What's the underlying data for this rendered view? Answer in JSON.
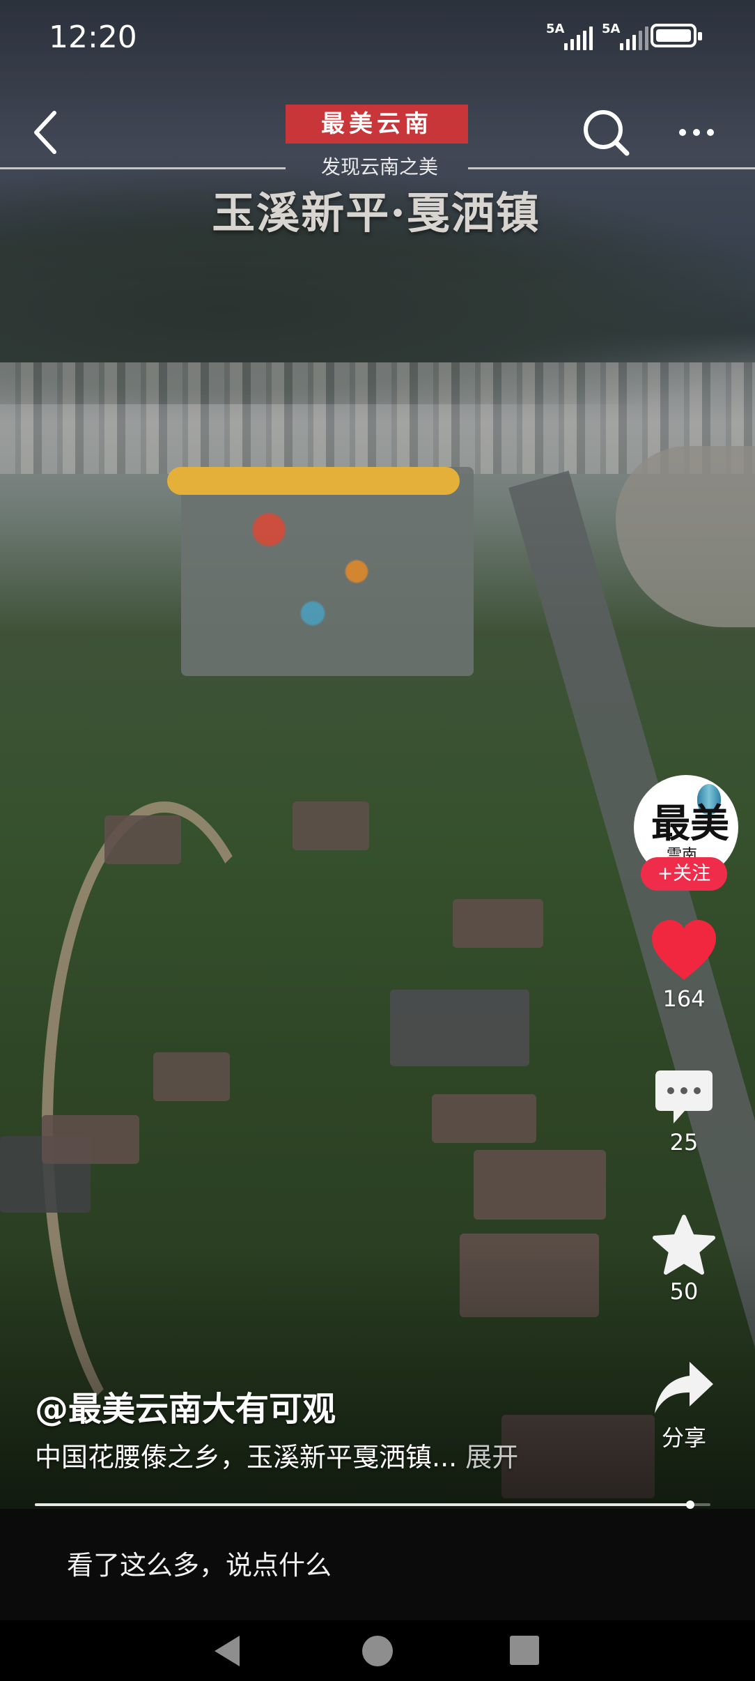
{
  "status_bar": {
    "time": "12:20",
    "signal_1_label": "5A",
    "signal_2_label": "5A",
    "battery_level": 1.0
  },
  "video": {
    "brand_badge": "最美云南",
    "overlay_subtitle": "发现云南之美",
    "overlay_title": "玉溪新平·戛洒镇"
  },
  "top_nav": {
    "back_icon": "chevron-left-icon",
    "search_icon": "search-icon",
    "more_icon": "more-dots-icon"
  },
  "rail": {
    "avatar_logo_text": "最美",
    "avatar_logo_sub": "雲南",
    "follow_label": "+关注",
    "like_count": "164",
    "comment_count": "25",
    "favorite_count": "50",
    "share_label": "分享",
    "like_color": "#f0273f"
  },
  "caption": {
    "author": "@最美云南大有可观",
    "text": "中国花腰傣之乡，玉溪新平戛洒镇...",
    "expand_label": "展开"
  },
  "progress": {
    "fraction": 0.97
  },
  "comment_bar": {
    "placeholder": "看了这么多，说点什么"
  },
  "nav_bar": {
    "back": "nav-back-icon",
    "home": "nav-home-icon",
    "recents": "nav-recents-icon"
  }
}
